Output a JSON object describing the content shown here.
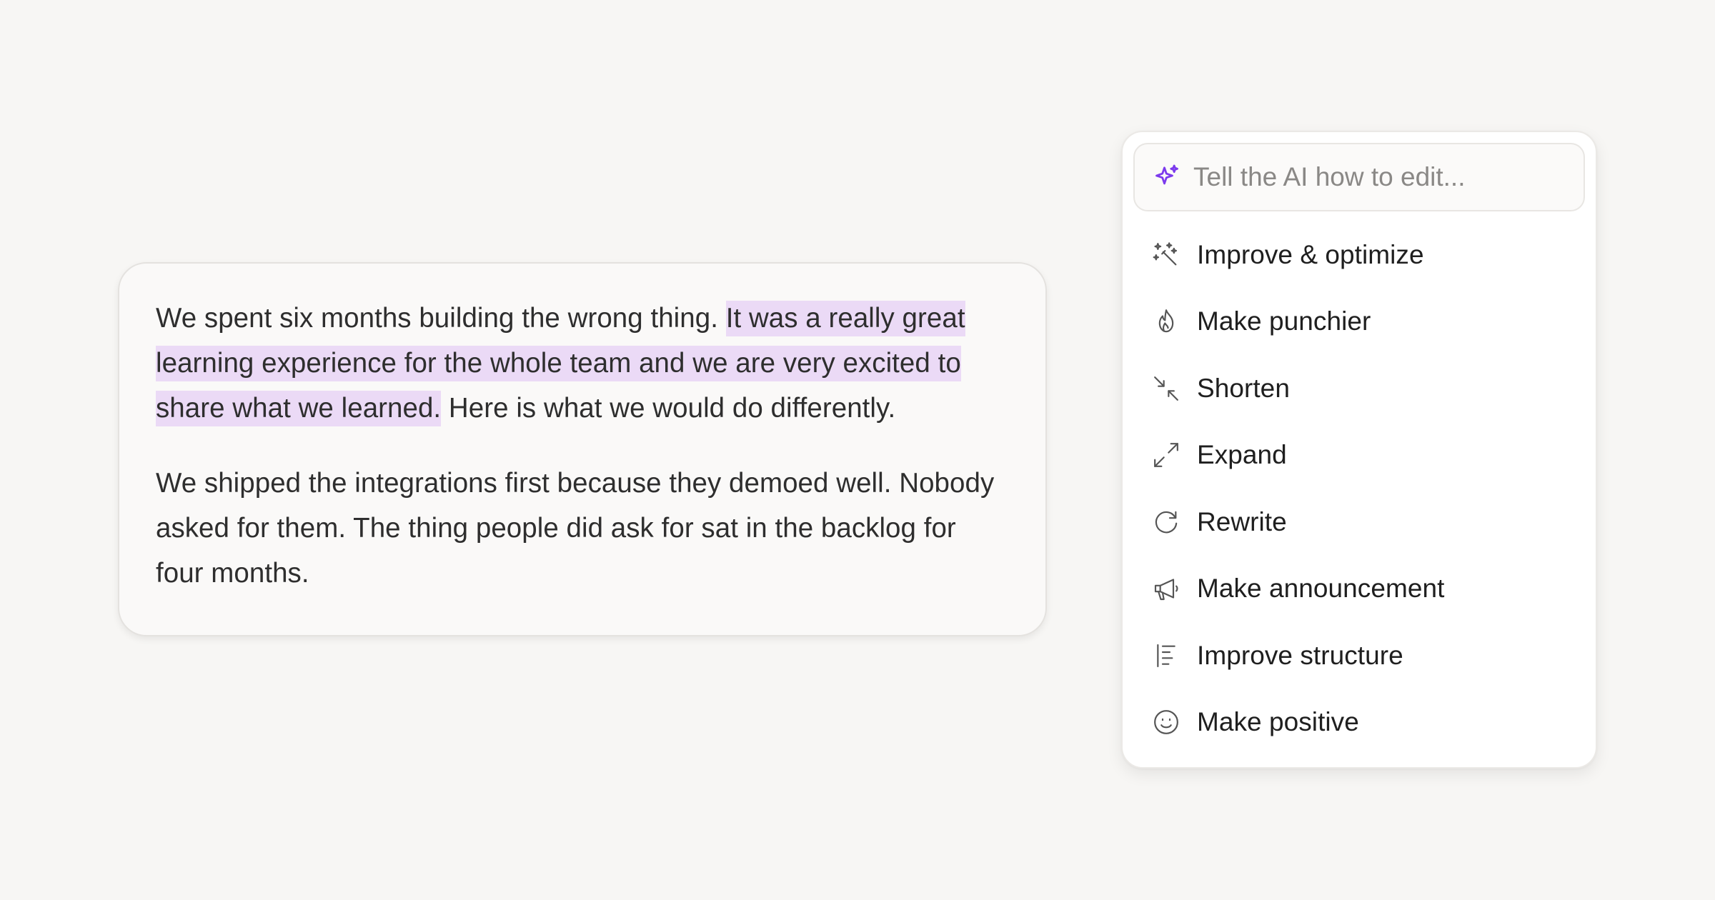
{
  "editor": {
    "paragraphs": [
      {
        "before": "We spent six months building the wrong thing. ",
        "highlighted": "It was a really great learning experience for the whole team and we are very excited to share what we learned.",
        "after": " Here is what we would do differently."
      },
      {
        "text": "We shipped the integrations first because they demoed well. Nobody asked for them. The thing people did ask for sat in the backlog for four months."
      }
    ],
    "highlight_color": "#ebdaf6"
  },
  "ai_menu": {
    "input": {
      "placeholder": "Tell the AI how to edit...",
      "value": "",
      "icon": "sparkle-icon",
      "icon_color": "#7c3aed"
    },
    "items": [
      {
        "label": "Improve & optimize",
        "icon": "magic-wand-icon"
      },
      {
        "label": "Make punchier",
        "icon": "flame-icon"
      },
      {
        "label": "Shorten",
        "icon": "arrows-in-icon"
      },
      {
        "label": "Expand",
        "icon": "arrows-out-icon"
      },
      {
        "label": "Rewrite",
        "icon": "refresh-icon"
      },
      {
        "label": "Make announcement",
        "icon": "megaphone-icon"
      },
      {
        "label": "Improve structure",
        "icon": "structure-icon"
      },
      {
        "label": "Make positive",
        "icon": "smiley-icon"
      }
    ]
  }
}
